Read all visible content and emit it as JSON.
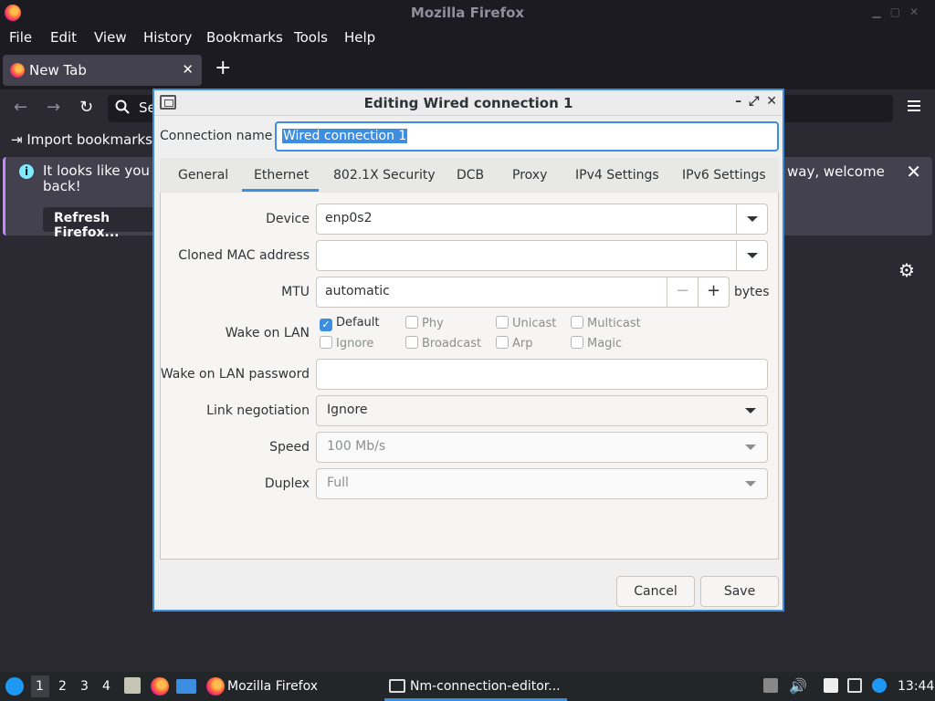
{
  "firefox": {
    "window_title": "Mozilla Firefox",
    "menu": [
      "File",
      "Edit",
      "View",
      "History",
      "Bookmarks",
      "Tools",
      "Help"
    ],
    "tab_label": "New Tab",
    "url_placeholder": "Se",
    "bookmark_import": "Import bookmarks...",
    "notice_left": "It looks like you ha",
    "notice_left_line2": "back!",
    "notice_right": "way, welcome",
    "notice_button": "Refresh Firefox..."
  },
  "dialog": {
    "title": "Editing Wired connection 1",
    "connection_name_label": "Connection name",
    "connection_name_value": "Wired connection 1",
    "tabs": [
      "General",
      "Ethernet",
      "802.1X Security",
      "DCB",
      "Proxy",
      "IPv4 Settings",
      "IPv6 Settings"
    ],
    "active_tab": "Ethernet",
    "device_label": "Device",
    "device_value": "enp0s2",
    "cloned_mac_label": "Cloned MAC address",
    "cloned_mac_value": "",
    "mtu_label": "MTU",
    "mtu_value": "automatic",
    "mtu_unit": "bytes",
    "wol_label": "Wake on LAN",
    "wol_options": [
      {
        "label": "Default",
        "checked": true
      },
      {
        "label": "Phy",
        "checked": false
      },
      {
        "label": "Unicast",
        "checked": false
      },
      {
        "label": "Multicast",
        "checked": false
      },
      {
        "label": "Ignore",
        "checked": false
      },
      {
        "label": "Broadcast",
        "checked": false
      },
      {
        "label": "Arp",
        "checked": false
      },
      {
        "label": "Magic",
        "checked": false
      }
    ],
    "wol_password_label": "Wake on LAN password",
    "wol_password_value": "",
    "link_negotiation_label": "Link negotiation",
    "link_negotiation_value": "Ignore",
    "speed_label": "Speed",
    "speed_value": "100 Mb/s",
    "duplex_label": "Duplex",
    "duplex_value": "Full",
    "cancel_label": "Cancel",
    "save_label": "Save"
  },
  "taskbar": {
    "workspaces": [
      "1",
      "2",
      "3",
      "4"
    ],
    "firefox_task": "Mozilla Firefox",
    "nm_task": "Nm-connection-editor...",
    "clock": "13:44"
  },
  "colors": {
    "accent": "#3d8ee0",
    "firefox_bg": "#2b2a33",
    "dialog_bg": "#efefef"
  }
}
